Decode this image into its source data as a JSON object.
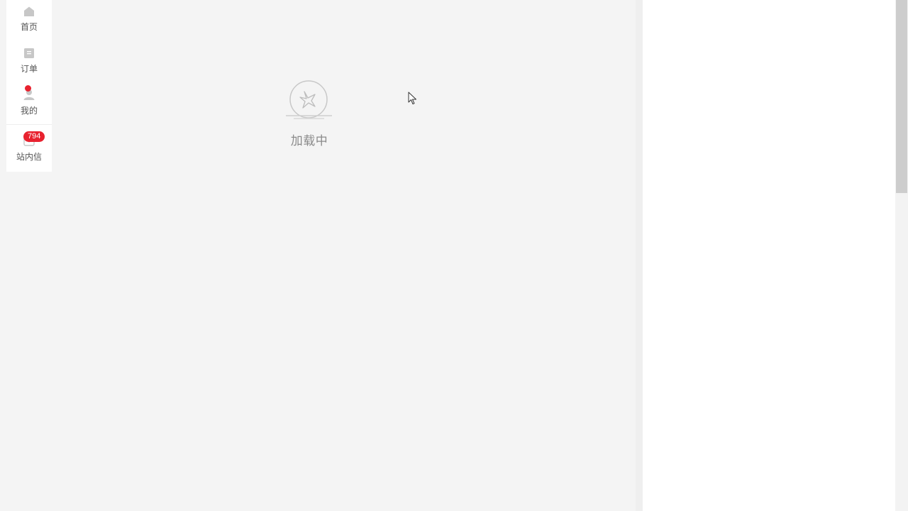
{
  "nav": {
    "items": [
      {
        "label": "首页",
        "icon": "home-icon"
      },
      {
        "label": "订单",
        "icon": "order-icon"
      },
      {
        "label": "我的",
        "icon": "user-icon"
      },
      {
        "label": "站内信",
        "icon": "mail-icon"
      }
    ],
    "messages_count": "794"
  },
  "loading": {
    "text": "加载中"
  },
  "colors": {
    "badge": "#e8222f",
    "icon_gray": "#c7c7c7",
    "background": "#f4f4f4"
  }
}
